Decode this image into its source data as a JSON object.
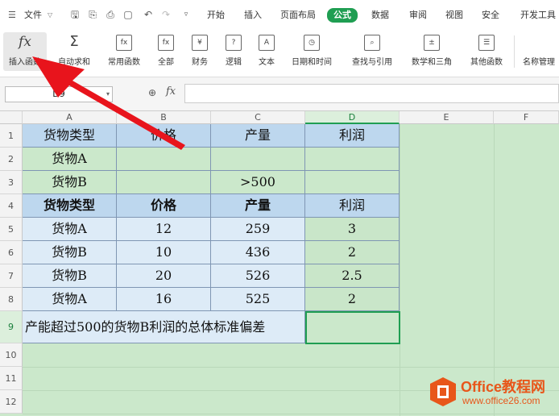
{
  "menubar": {
    "file_label": "文件",
    "tabs": [
      "开始",
      "插入",
      "页面布局",
      "公式",
      "数据",
      "审阅",
      "视图",
      "安全",
      "开发工具"
    ],
    "active_tab": "公式"
  },
  "ribbon": {
    "items": [
      "插入函数",
      "自动求和",
      "常用函数",
      "全部",
      "财务",
      "逻辑",
      "文本",
      "日期和时间",
      "查找与引用",
      "数学和三角",
      "其他函数",
      "名称管理"
    ]
  },
  "formula_bar": {
    "name_box": "D9",
    "fx_label": "fx",
    "formula": ""
  },
  "sheet": {
    "columns": [
      "A",
      "B",
      "C",
      "D",
      "E",
      "F"
    ],
    "rows": [
      "1",
      "2",
      "3",
      "4",
      "5",
      "6",
      "7",
      "8",
      "9",
      "10",
      "11",
      "12"
    ],
    "criteria_header": [
      "货物类型",
      "价格",
      "产量",
      "利润"
    ],
    "criteria_rows": [
      [
        "货物A",
        "",
        "",
        ""
      ],
      [
        "货物B",
        "",
        ">500",
        ""
      ]
    ],
    "data_header": [
      "货物类型",
      "价格",
      "产量",
      "利润"
    ],
    "data_rows": [
      [
        "货物A",
        "12",
        "259",
        "3"
      ],
      [
        "货物B",
        "10",
        "436",
        "2"
      ],
      [
        "货物B",
        "20",
        "526",
        "2.5"
      ],
      [
        "货物A",
        "16",
        "525",
        "2"
      ]
    ],
    "question": "产能超过500的货物B利润的总体标准偏差",
    "answer": ""
  },
  "watermark": {
    "brand": "Office教程网",
    "url": "www.office26.com"
  }
}
